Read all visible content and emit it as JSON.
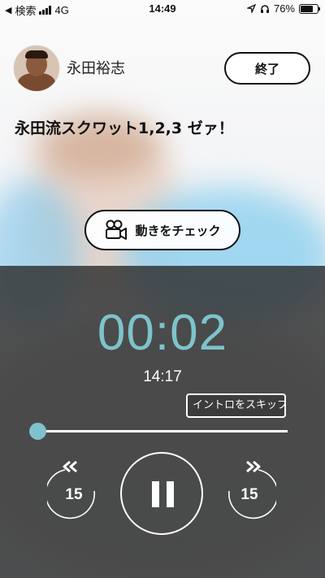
{
  "status_bar": {
    "carrier": "検索",
    "network": "4G",
    "time": "14:49",
    "battery": "76%"
  },
  "header": {
    "coach_name": "永田裕志",
    "end_label": "終了"
  },
  "workout": {
    "title": "永田流スクワット1,2,3 ゼァ！",
    "check_motion_label": "動きをチェック"
  },
  "player": {
    "elapsed": "00:02",
    "remaining": "14:17",
    "skip_intro_label": "イントロをスキップ",
    "progress": 0.0,
    "rewind_seconds": "15",
    "forward_seconds": "15",
    "accent_color": "#7ec3cc"
  },
  "icons": [
    "location-arrow-icon",
    "headphones-icon",
    "battery-icon",
    "video-camera-icon",
    "rewind-icon",
    "pause-icon",
    "forward-icon"
  ]
}
